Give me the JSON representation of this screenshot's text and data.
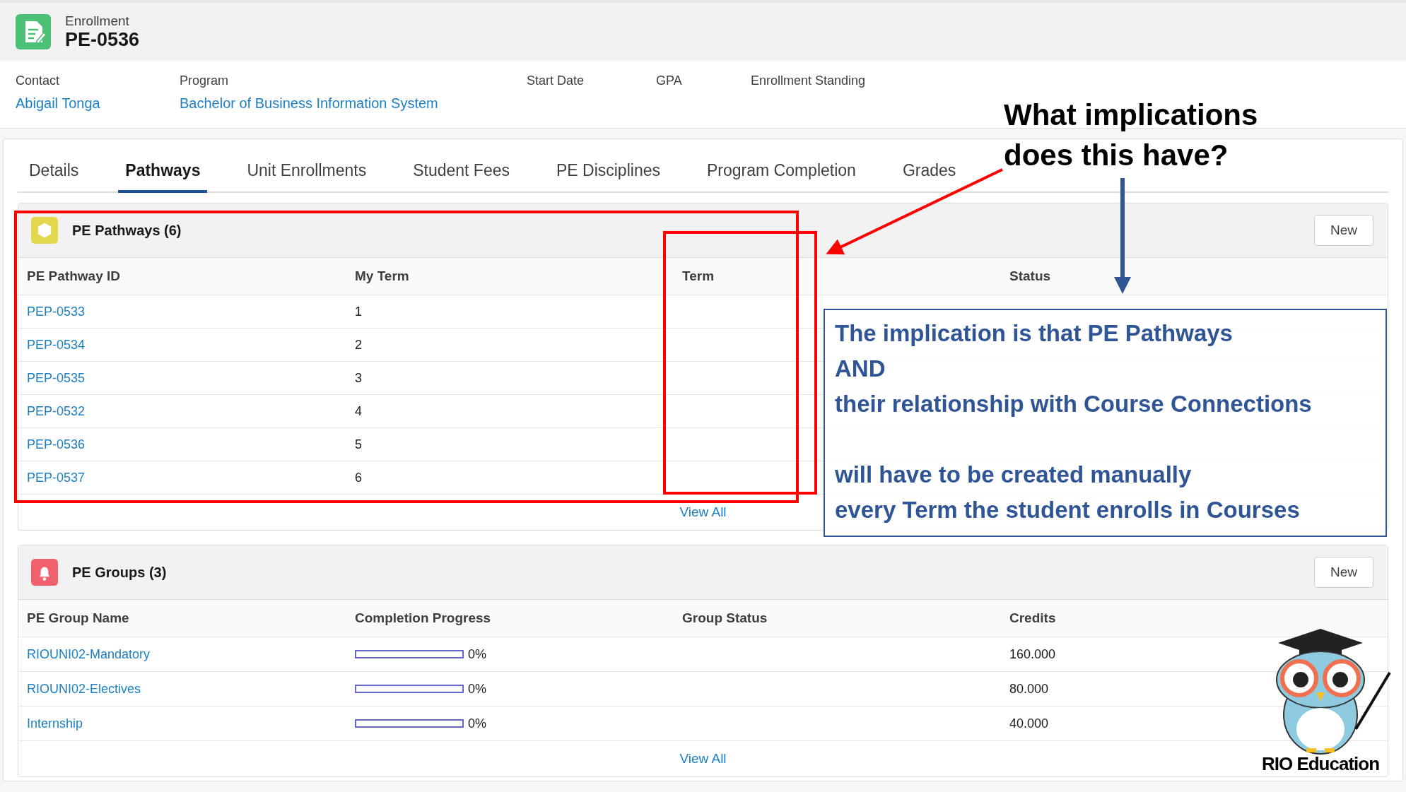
{
  "record": {
    "object_label": "Enrollment",
    "name": "PE-0536"
  },
  "fields": [
    {
      "label": "Contact",
      "value": "Abigail Tonga"
    },
    {
      "label": "Program",
      "value": "Bachelor of Business Information System"
    },
    {
      "label": "Start Date"
    },
    {
      "label": "GPA"
    },
    {
      "label": "Enrollment Standing"
    }
  ],
  "tabs": [
    {
      "label": "Details",
      "selected": false
    },
    {
      "label": "Pathways",
      "selected": true
    },
    {
      "label": "Unit Enrollments",
      "selected": false
    },
    {
      "label": "Student Fees",
      "selected": false
    },
    {
      "label": "PE Disciplines",
      "selected": false
    },
    {
      "label": "Program Completion",
      "selected": false
    },
    {
      "label": "Grades",
      "selected": false
    }
  ],
  "pathways": {
    "title": "PE Pathways (6)",
    "new_button": "New",
    "columns": [
      "PE Pathway ID",
      "My Term",
      "Term",
      "Status"
    ],
    "rows": [
      {
        "id": "PEP-0533",
        "my_term": "1"
      },
      {
        "id": "PEP-0534",
        "my_term": "2"
      },
      {
        "id": "PEP-0535",
        "my_term": "3"
      },
      {
        "id": "PEP-0532",
        "my_term": "4"
      },
      {
        "id": "PEP-0536",
        "my_term": "5"
      },
      {
        "id": "PEP-0537",
        "my_term": "6"
      }
    ],
    "view_all": "View All"
  },
  "groups": {
    "title": "PE Groups (3)",
    "new_button": "New",
    "columns": [
      "PE Group Name",
      "Completion Progress",
      "Group Status",
      "Credits"
    ],
    "rows": [
      {
        "name": "RIOUNI02-Mandatory",
        "level": 0,
        "progress": "0%",
        "credits": "160.000"
      },
      {
        "name": "RIOUNI02-Electives",
        "level": 0,
        "progress": "0%",
        "credits": "80.000"
      },
      {
        "name": "Internship",
        "level": 0,
        "progress": "0%",
        "credits": "40.000"
      }
    ],
    "view_all": "View All"
  },
  "annotations": {
    "question": "What implications does this have?",
    "callout": [
      [
        "The implication is that PE Pathways",
        "AND",
        "their relationship with Course Connections"
      ],
      [
        "will have to be created manually",
        "every Term the student enrolls in Courses"
      ]
    ]
  },
  "logo": {
    "text": "RIO Education"
  }
}
